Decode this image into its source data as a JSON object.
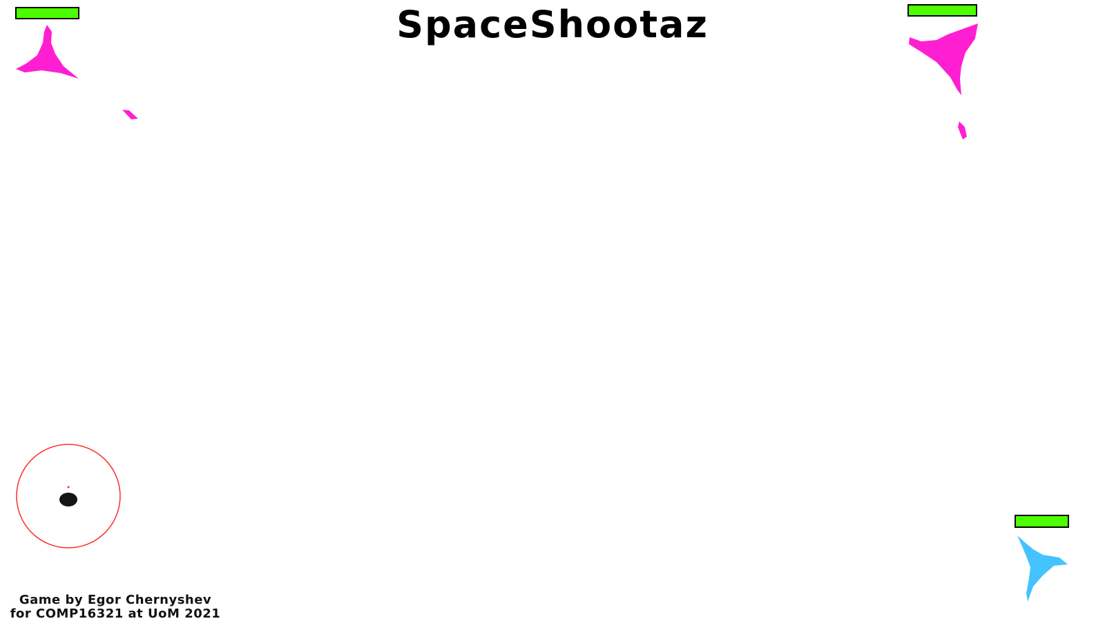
{
  "game": {
    "title": "SpaceShootaz",
    "credits": {
      "line1": "Game by Egor Chernyshev",
      "line2": "for COMP16321 at UoM 2021"
    }
  },
  "colors": {
    "enemy": "#ff1fd2",
    "player": "#45c3ff",
    "health": "#4cff00",
    "health_border": "#000000",
    "joystick_ring": "#ff2a2a",
    "joystick_knob": "#151515"
  },
  "entities": {
    "enemy_top_left": {
      "type": "enemy-ship",
      "health_fraction": 1.0
    },
    "enemy_top_right": {
      "type": "enemy-ship",
      "health_fraction": 1.0
    },
    "player": {
      "type": "player-ship",
      "health_fraction": 1.0
    }
  }
}
